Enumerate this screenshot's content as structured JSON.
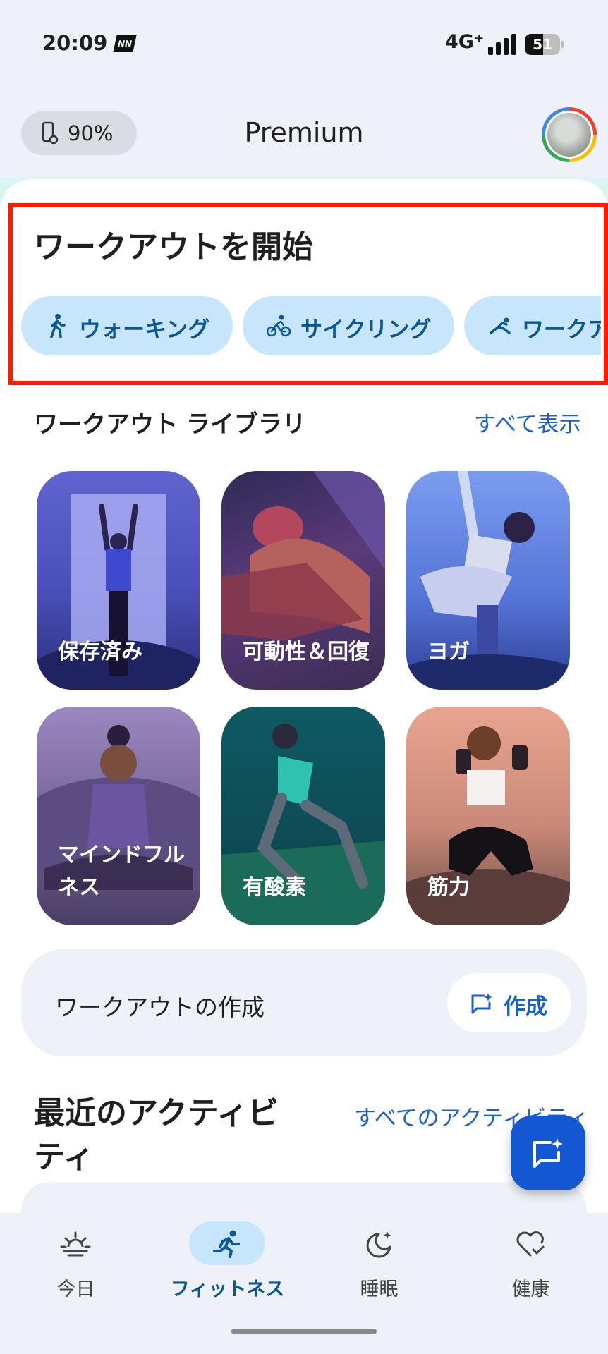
{
  "status_bar": {
    "time": "20:09",
    "notification_badge": "NN",
    "network": "4G⁺",
    "battery_level": 51,
    "battery_text": "51"
  },
  "header": {
    "device_battery": "90%",
    "title": "Premium"
  },
  "start_workout": {
    "title": "ワークアウトを開始",
    "chips": [
      {
        "label": "ウォーキング",
        "icon": "walking-icon"
      },
      {
        "label": "サイクリング",
        "icon": "cycling-icon"
      },
      {
        "label": "ワークアウト",
        "icon": "workout-icon"
      }
    ]
  },
  "library": {
    "title": "ワークアウト ライブラリ",
    "see_all": "すべて表示",
    "tiles": [
      {
        "label": "保存済み",
        "color": "#5b5fc7"
      },
      {
        "label": "可動性＆回復",
        "color": "#4a3a6b"
      },
      {
        "label": "ヨガ",
        "color": "#6a8de0"
      },
      {
        "label": "マインドフルネス",
        "color": "#7b6a9e"
      },
      {
        "label": "有酸素",
        "color": "#0f5a63"
      },
      {
        "label": "筋力",
        "color": "#c98978"
      }
    ]
  },
  "create": {
    "text": "ワークアウトの作成",
    "button": "作成"
  },
  "recent": {
    "title": "最近のアクティビティ",
    "link": "すべてのアクティビティ"
  },
  "bottom_nav": [
    {
      "label": "今日",
      "icon": "sunrise-icon",
      "active": false
    },
    {
      "label": "フィットネス",
      "icon": "running-icon",
      "active": true
    },
    {
      "label": "睡眠",
      "icon": "moon-icon",
      "active": false
    },
    {
      "label": "健康",
      "icon": "heart-check-icon",
      "active": false
    }
  ],
  "colors": {
    "accent": "#1a5fcf",
    "chip_bg": "#c8e6fb",
    "highlight": "#ff1a00",
    "fab": "#1457d2"
  }
}
